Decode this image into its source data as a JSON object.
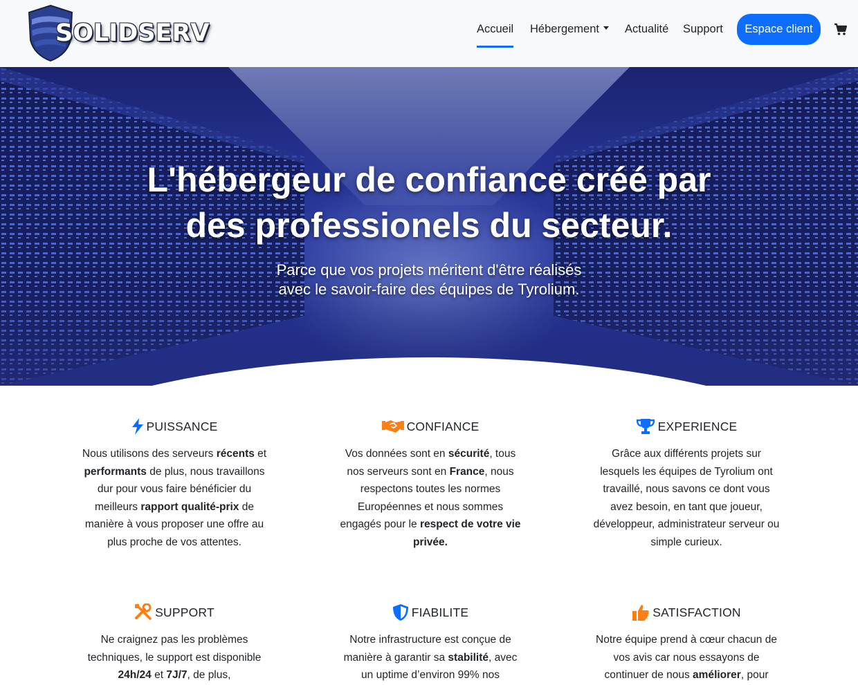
{
  "brand": {
    "name": "SOLIDSERV"
  },
  "nav": {
    "items": [
      {
        "label": "Accueil"
      },
      {
        "label": "Hébergement"
      },
      {
        "label": "Actualité"
      },
      {
        "label": "Support"
      }
    ],
    "client_button": "Espace client",
    "cart_icon": "shopping-cart-icon"
  },
  "hero": {
    "title_line1": "L'hébergeur de confiance créé par",
    "title_line2": "des professionels du secteur.",
    "subtitle_line1": "Parce que vos projets méritent d'être réalisés",
    "subtitle_line2": "avec le savoir-faire des équipes de Tyrolium."
  },
  "features": [
    {
      "icon": "bolt-icon",
      "color": "#0d6efd",
      "title": "PUISSANCE",
      "segments": [
        {
          "t": "Nous utilisons des serveurs "
        },
        {
          "b": "récents"
        },
        {
          "t": " et "
        },
        {
          "b": "performants"
        },
        {
          "t": " de plus, nous travaillons dur pour vous faire bénéficier du meilleurs "
        },
        {
          "b": "rapport qualité-prix"
        },
        {
          "t": " de manière à vous proposer une offre au plus proche de vos attentes."
        }
      ]
    },
    {
      "icon": "handshake-icon",
      "color": "#fd7e14",
      "title": "CONFIANCE",
      "segments": [
        {
          "t": "Vos données sont en "
        },
        {
          "b": "sécurité"
        },
        {
          "t": ", tous nos serveurs sont en "
        },
        {
          "b": "France"
        },
        {
          "t": ", nous respectons toutes les normes Européennes et nous sommes engagés pour le "
        },
        {
          "b": "respect de votre vie privée."
        }
      ]
    },
    {
      "icon": "trophy-icon",
      "color": "#0d6efd",
      "title": "EXPERIENCE",
      "segments": [
        {
          "t": "Grâce aux différents projets sur lesquels les équipes de Tyrolium ont travaillé, nous savons ce dont vous avez besoin, en tant que joueur, développeur, administrateur serveur ou simple curieux."
        }
      ]
    },
    {
      "icon": "tools-icon",
      "color": "#fd7e14",
      "title": "SUPPORT",
      "segments": [
        {
          "t": "Ne craignez pas les problèmes techniques, le support est disponible "
        },
        {
          "b": "24h/24"
        },
        {
          "t": " et "
        },
        {
          "b": "7J/7"
        },
        {
          "t": ", de plus,"
        }
      ]
    },
    {
      "icon": "shield-icon",
      "color": "#0d6efd",
      "title": "FIABILITE",
      "segments": [
        {
          "t": "Notre infrastructure est conçue de manière à garantir sa "
        },
        {
          "b": "stabilité"
        },
        {
          "t": ", avec un uptime d’environ 99% nos"
        }
      ]
    },
    {
      "icon": "thumbs-up-icon",
      "color": "#fd7e14",
      "title": "SATISFACTION",
      "segments": [
        {
          "t": "Notre équipe prend à cœur chacun de vos avis car nous essayons de continuer de nous "
        },
        {
          "b": "améliorer"
        },
        {
          "t": ", pour"
        }
      ]
    }
  ]
}
